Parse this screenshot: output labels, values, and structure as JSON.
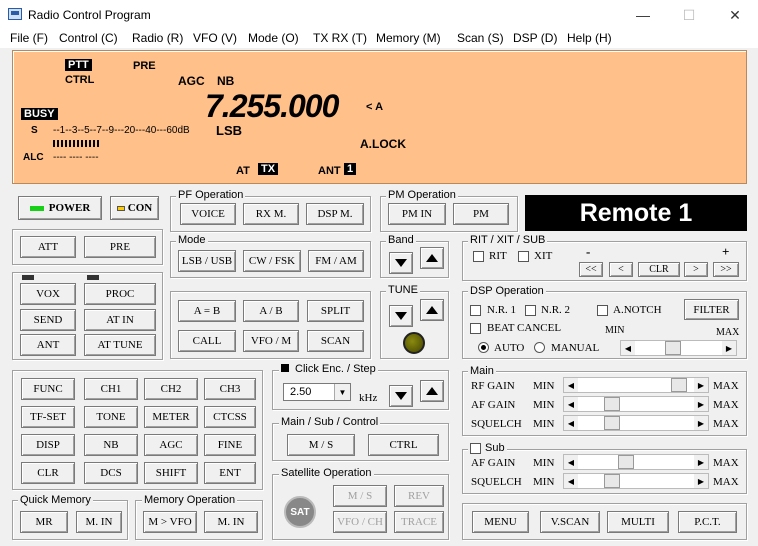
{
  "window": {
    "title": "Radio Control Program",
    "min": "—",
    "max": "☐",
    "close": "✕"
  },
  "menu": [
    "File (F)",
    "Control (C)",
    "Radio (R)",
    "VFO (V)",
    "Mode (O)",
    "TX RX (T)",
    "Memory (M)",
    "Scan (S)",
    "DSP (D)",
    "Help (H)"
  ],
  "display": {
    "ptt": "PTT",
    "ctrl": "CTRL",
    "pre": "PRE",
    "agc": "AGC",
    "nb": "NB",
    "busy": "BUSY",
    "s": "S",
    "scale": "--1--3--5--7--9---20---40---60dB",
    "alc": "ALC",
    "alc_bars": "----   ----   ----",
    "freq": "7.255.000",
    "vfo": "< A",
    "mode": "LSB",
    "alock": "A.LOCK",
    "at": "AT",
    "tx": "TX",
    "ant": "ANT",
    "ant_num": "1"
  },
  "left": {
    "power": "POWER",
    "con": "CON",
    "att": "ATT",
    "pre": "PRE",
    "vox": "VOX",
    "proc": "PROC",
    "send": "SEND",
    "at_in": "AT IN",
    "ant": "ANT",
    "at_tune": "AT TUNE"
  },
  "fkeys": [
    "FUNC",
    "CH1",
    "CH2",
    "CH3",
    "TF-SET",
    "TONE",
    "METER",
    "CTCSS",
    "DISP",
    "NB",
    "AGC",
    "FINE",
    "CLR",
    "DCS",
    "SHIFT",
    "ENT"
  ],
  "quick_memory": {
    "label": "Quick Memory",
    "mr": "MR",
    "min": "M. IN"
  },
  "memory_op": {
    "label": "Memory Operation",
    "mvfo": "M > VFO",
    "min": "M. IN"
  },
  "pf": {
    "label": "PF Operation",
    "voice": "VOICE",
    "rxm": "RX M.",
    "dspm": "DSP M."
  },
  "pm": {
    "label": "PM Operation",
    "pmin": "PM IN",
    "pm": "PM"
  },
  "remote": "Remote 1",
  "mode": {
    "label": "Mode",
    "lsbusb": "LSB / USB",
    "cwfsk": "CW / FSK",
    "fmam": "FM / AM"
  },
  "band": {
    "label": "Band"
  },
  "tune": {
    "label": "TUNE"
  },
  "vfo": {
    "aeqb": "A = B",
    "ab": "A / B",
    "split": "SPLIT",
    "call": "CALL",
    "vfom": "VFO / M",
    "scan": "SCAN"
  },
  "click": {
    "label": "Click Enc. / Step",
    "value": "2.50",
    "unit": "kHz"
  },
  "msc": {
    "label": "Main / Sub / Control",
    "ms": "M / S",
    "ctrl": "CTRL"
  },
  "sat": {
    "label": "Satellite Operation",
    "icon": "SAT",
    "ms": "M / S",
    "rev": "REV",
    "vfoch": "VFO / CH",
    "trace": "TRACE"
  },
  "rit": {
    "label": "RIT / XIT / SUB",
    "rit": "RIT",
    "xit": "XIT",
    "minus": "-",
    "plus": "+",
    "ll": "<<",
    "l": "<",
    "clr": "CLR",
    "r": ">",
    "rr": ">>"
  },
  "dsp": {
    "label": "DSP Operation",
    "nr1": "N.R. 1",
    "nr2": "N.R. 2",
    "anotch": "A.NOTCH",
    "filter": "FILTER",
    "beat": "BEAT CANCEL",
    "min": "MIN",
    "max": "MAX",
    "auto": "AUTO",
    "manual": "MANUAL"
  },
  "main": {
    "label": "Main",
    "rf": "RF GAIN",
    "af": "AF GAIN",
    "sq": "SQUELCH",
    "min": "MIN",
    "max": "MAX",
    "levels": {
      "rf": 0.93,
      "af": 0.26,
      "sq": 0.26
    }
  },
  "sub": {
    "label": "Sub",
    "af": "AF GAIN",
    "sq": "SQUELCH",
    "min": "MIN",
    "max": "MAX",
    "levels": {
      "af": 0.4,
      "sq": 0.26
    }
  },
  "bottom": {
    "menu": "MENU",
    "vscan": "V.SCAN",
    "multi": "MULTI",
    "pct": "P.C.T."
  }
}
